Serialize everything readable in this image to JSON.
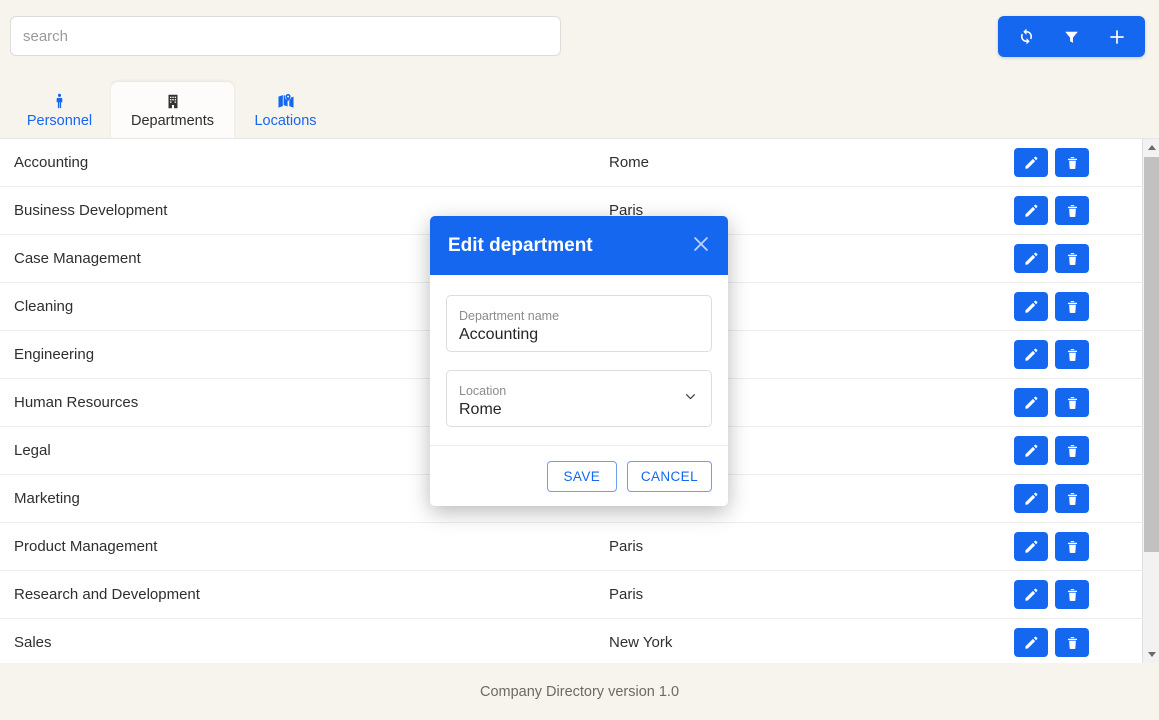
{
  "search": {
    "placeholder": "search",
    "value": ""
  },
  "toolbar": {
    "refresh_label": "refresh-icon",
    "filter_label": "filter-icon",
    "add_label": "add-icon",
    "accent_color": "#1667f0"
  },
  "tabs": [
    {
      "label": "Personnel",
      "icon": "person-icon",
      "active": false
    },
    {
      "label": "Departments",
      "icon": "building-icon",
      "active": true
    },
    {
      "label": "Locations",
      "icon": "map-icon",
      "active": false
    }
  ],
  "list": {
    "rows": [
      {
        "name": "Accounting",
        "location": "Rome"
      },
      {
        "name": "Business Development",
        "location": "Paris"
      },
      {
        "name": "Case Management",
        "location": ""
      },
      {
        "name": "Cleaning",
        "location": ""
      },
      {
        "name": "Engineering",
        "location": ""
      },
      {
        "name": "Human Resources",
        "location": ""
      },
      {
        "name": "Legal",
        "location": ""
      },
      {
        "name": "Marketing",
        "location": ""
      },
      {
        "name": "Product Management",
        "location": "Paris"
      },
      {
        "name": "Research and Development",
        "location": "Paris"
      },
      {
        "name": "Sales",
        "location": "New York"
      }
    ],
    "edit_action": "edit-icon",
    "delete_action": "delete-icon"
  },
  "modal": {
    "title": "Edit department",
    "close_label": "close-icon",
    "fields": [
      {
        "label": "Department name",
        "value": "Accounting",
        "type": "text"
      },
      {
        "label": "Location",
        "value": "Rome",
        "type": "select"
      }
    ],
    "save_label": "SAVE",
    "cancel_label": "CANCEL"
  },
  "footer": {
    "text": "Company Directory version 1.0"
  }
}
